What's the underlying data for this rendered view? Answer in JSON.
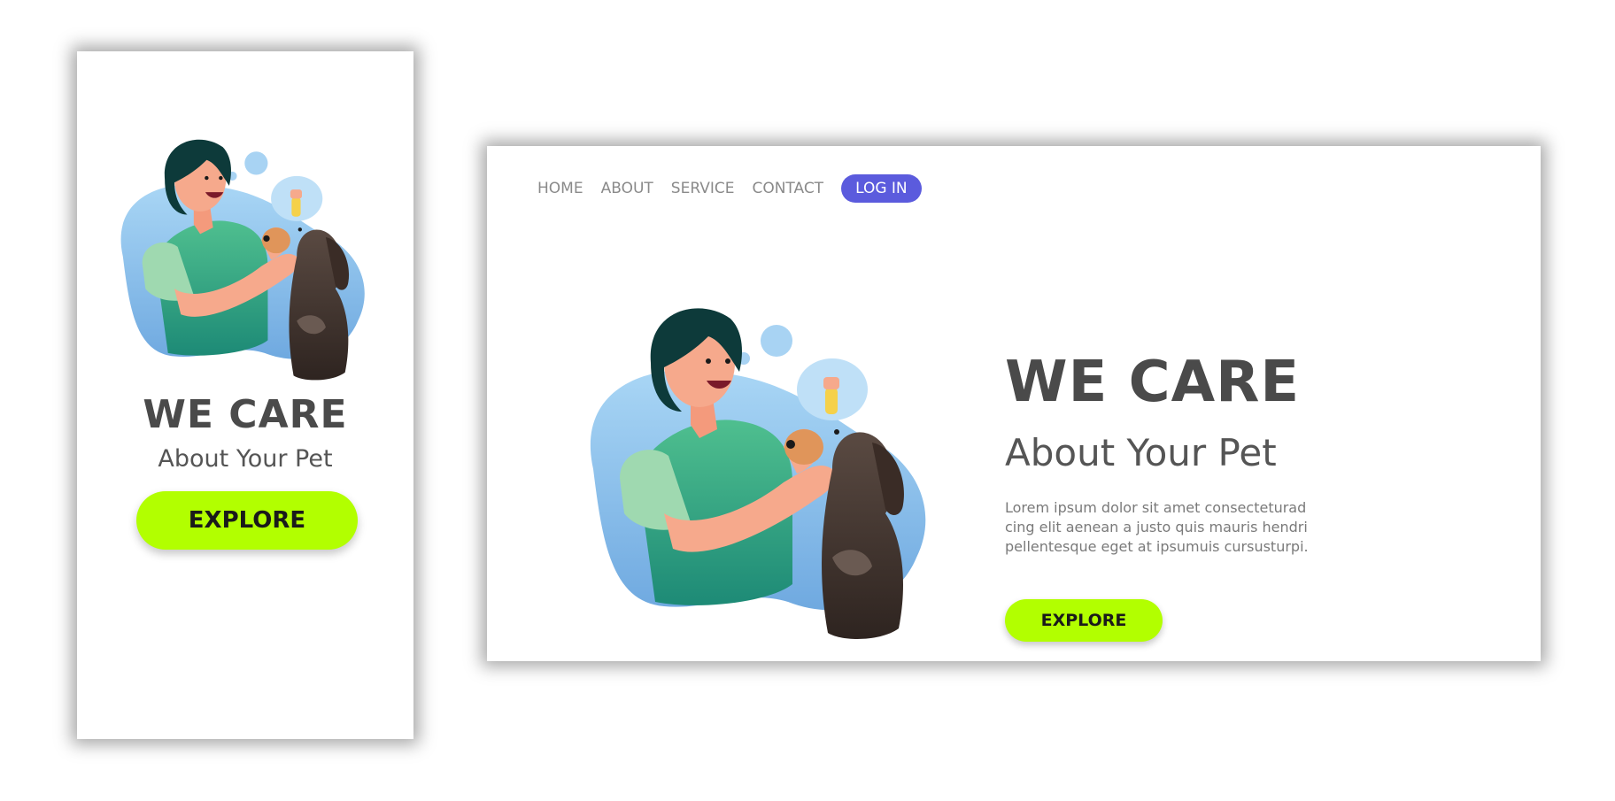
{
  "mobile": {
    "headline": "WE CARE",
    "subheadline": "About Your Pet",
    "explore_label": "EXPLORE"
  },
  "desktop": {
    "nav": [
      {
        "label": "HOME"
      },
      {
        "label": "ABOUT"
      },
      {
        "label": "SERVICE"
      },
      {
        "label": "CONTACT"
      }
    ],
    "login_label": "LOG IN",
    "headline": "WE CARE",
    "subheadline": "About Your Pet",
    "body": "Lorem ipsum dolor sit amet consectetur adipiscing elit aenean a justo quis mauris hendrerit pellentesque eget at ipsum uis cursus turpis.",
    "body_lines": [
      "Lorem ipsum dolor sit amet consecteturad",
      "cing elit aenean a justo quis mauris hendri",
      "pellentesque eget at ipsumuis cursusturpi."
    ],
    "explore_label": "EXPLORE"
  },
  "colors": {
    "accent_green": "#b2ff00",
    "login_purple": "#5b5bdd",
    "heading_gray": "#4a4a4a",
    "nav_gray": "#8a8a8a",
    "blob_blue": "#8ec5ee",
    "shirt_green": "#2e9e7a",
    "skin": "#f6a98c",
    "hair": "#0d3a3a",
    "dog_brown": "#4a3a33"
  },
  "icons": {
    "illustration": "woman-cleaning-dog-ears-illustration"
  }
}
